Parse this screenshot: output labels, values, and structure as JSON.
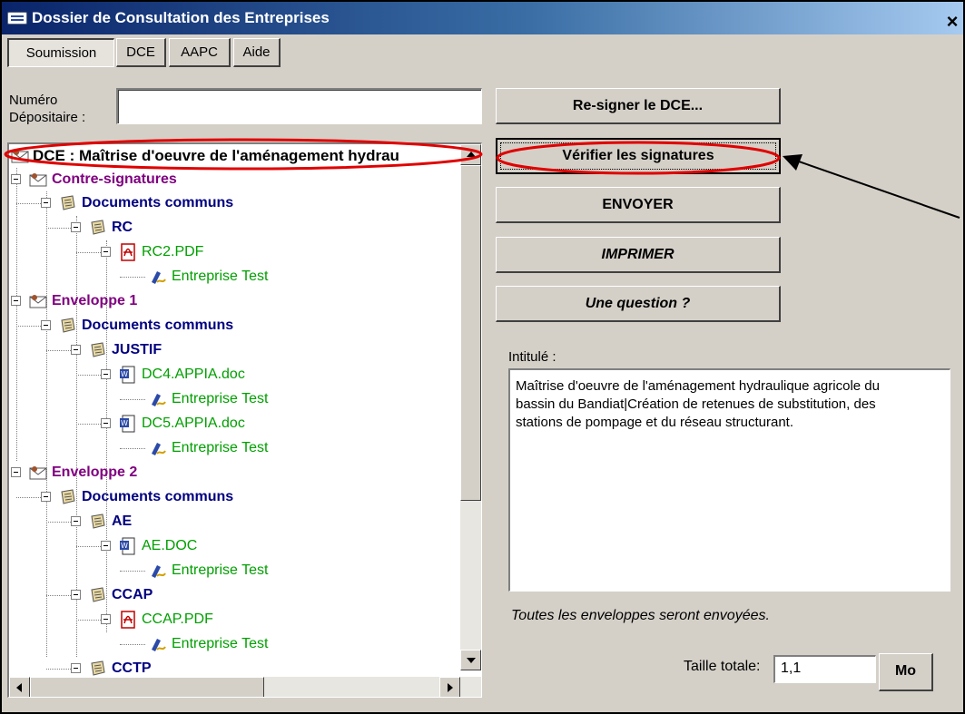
{
  "window": {
    "title": "Dossier de Consultation des Entreprises",
    "close": "×"
  },
  "tabs": [
    {
      "label": "Soumission"
    },
    {
      "label": "DCE"
    },
    {
      "label": "AAPC"
    },
    {
      "label": "Aide"
    }
  ],
  "depositaire": {
    "label_line1": "Numéro",
    "label_line2": "Dépositaire :",
    "value": ""
  },
  "buttons": {
    "resign": "Re-signer le DCE...",
    "verify": "Vérifier les signatures",
    "send": "ENVOYER",
    "print": "IMPRIMER",
    "question": "Une question ?"
  },
  "tree": {
    "root": "DCE : Maîtrise d'oeuvre de l'aménagement hydrau",
    "nodes": [
      {
        "label": "Contre-signatures",
        "style": "purple",
        "icon": "envelope-icon"
      },
      {
        "label": "Documents communs",
        "style": "navy",
        "icon": "folder-icon"
      },
      {
        "label": "RC",
        "style": "navy",
        "icon": "folder-icon"
      },
      {
        "label": "RC2.PDF",
        "style": "green",
        "icon": "pdf-icon"
      },
      {
        "label": "Entreprise Test",
        "style": "green",
        "icon": "signature-icon"
      },
      {
        "label": "Enveloppe 1",
        "style": "purple",
        "icon": "envelope-icon"
      },
      {
        "label": "Documents communs",
        "style": "navy",
        "icon": "folder-icon"
      },
      {
        "label": "JUSTIF",
        "style": "navy",
        "icon": "folder-icon"
      },
      {
        "label": "DC4.APPIA.doc",
        "style": "green",
        "icon": "word-icon"
      },
      {
        "label": "Entreprise Test",
        "style": "green",
        "icon": "signature-icon"
      },
      {
        "label": "DC5.APPIA.doc",
        "style": "green",
        "icon": "word-icon"
      },
      {
        "label": "Entreprise Test",
        "style": "green",
        "icon": "signature-icon"
      },
      {
        "label": "Enveloppe 2",
        "style": "purple",
        "icon": "envelope-icon"
      },
      {
        "label": "Documents communs",
        "style": "navy",
        "icon": "folder-icon"
      },
      {
        "label": "AE",
        "style": "navy",
        "icon": "folder-icon"
      },
      {
        "label": "AE.DOC",
        "style": "green",
        "icon": "word-icon"
      },
      {
        "label": "Entreprise Test",
        "style": "green",
        "icon": "signature-icon"
      },
      {
        "label": "CCAP",
        "style": "navy",
        "icon": "folder-icon"
      },
      {
        "label": "CCAP.PDF",
        "style": "green",
        "icon": "pdf-icon"
      },
      {
        "label": "Entreprise Test",
        "style": "green",
        "icon": "signature-icon"
      },
      {
        "label": "CCTP",
        "style": "navy",
        "icon": "folder-icon"
      }
    ]
  },
  "intitule": {
    "label": "Intitulé :",
    "line1": "Maîtrise d'oeuvre de l'aménagement hydraulique agricole du",
    "line2": "bassin du Bandiat|Création de retenues de substitution, des",
    "line3": "stations de pompage et du réseau structurant."
  },
  "info": "Toutes les enveloppes seront envoyées.",
  "taille": {
    "label": "Taille totale:",
    "value": "1,1",
    "unit_button": "Mo"
  },
  "colors": {
    "annotation": "#e00000",
    "purple": "#800080",
    "navy": "#000080",
    "green": "#00a000",
    "title_bar": "#0a246a"
  }
}
